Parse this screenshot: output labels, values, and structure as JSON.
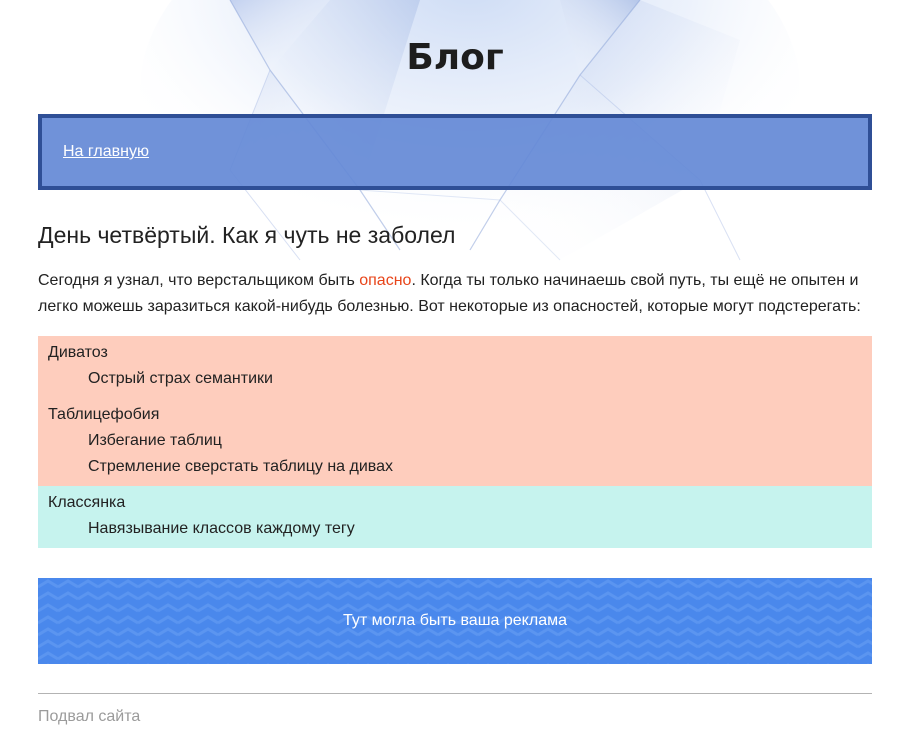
{
  "header": {
    "title": "Блог"
  },
  "nav": {
    "home_link": "На главную"
  },
  "post": {
    "title": "День четвёртый. Как я чуть не заболел",
    "intro_before": "Сегодня я узнал, что верстальщиком быть ",
    "intro_highlight": "опасно",
    "intro_after": ". Когда ты только начинаешь свой путь, ты ещё не опытен и легко можешь заразиться какой-нибудь болезнью. Вот некоторые из опасностей, которые могут подстерегать:"
  },
  "diseases": [
    {
      "term": "Диватоз",
      "descriptions": [
        "Острый страх семантики"
      ]
    },
    {
      "term": "Таблицефобия",
      "descriptions": [
        "Избегание таблиц",
        "Стремление сверстать таблицу на дивах"
      ]
    },
    {
      "term": "Классянка",
      "descriptions": [
        "Навязывание классов каждому тегу"
      ]
    }
  ],
  "ad": {
    "text": "Тут могла быть ваша реклама"
  },
  "footer": {
    "text": "Подвал сайта"
  },
  "colors": {
    "nav_background": "#6489d6",
    "nav_border": "#2f4f96",
    "highlight": "#e8451a",
    "orange_block": "#fecdbd",
    "mint_block": "#c6f3ee",
    "ad_background": "#4a88ec"
  }
}
